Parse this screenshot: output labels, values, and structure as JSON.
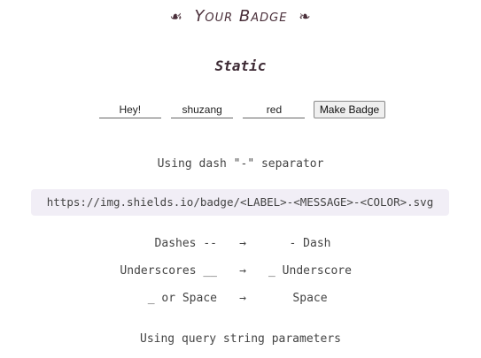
{
  "header": {
    "title": "Your Badge",
    "ornament_left": "☙",
    "ornament_right": "❧"
  },
  "section": {
    "title": "Static"
  },
  "form": {
    "label_value": "Hey!",
    "message_value": "shuzang",
    "color_value": "red",
    "submit_label": "Make Badge"
  },
  "separator_note": "Using dash \"-\" separator",
  "url_template": "https://img.shields.io/badge/<LABEL>-<MESSAGE>-<COLOR>.svg",
  "escape_table": [
    {
      "input": "Dashes --",
      "arrow": "→",
      "output": "- Dash"
    },
    {
      "input": "Underscores __",
      "arrow": "→",
      "output": "_ Underscore"
    },
    {
      "input": "_ or Space",
      "arrow": "→",
      "output": "Space"
    }
  ],
  "query_note": "Using query string parameters"
}
